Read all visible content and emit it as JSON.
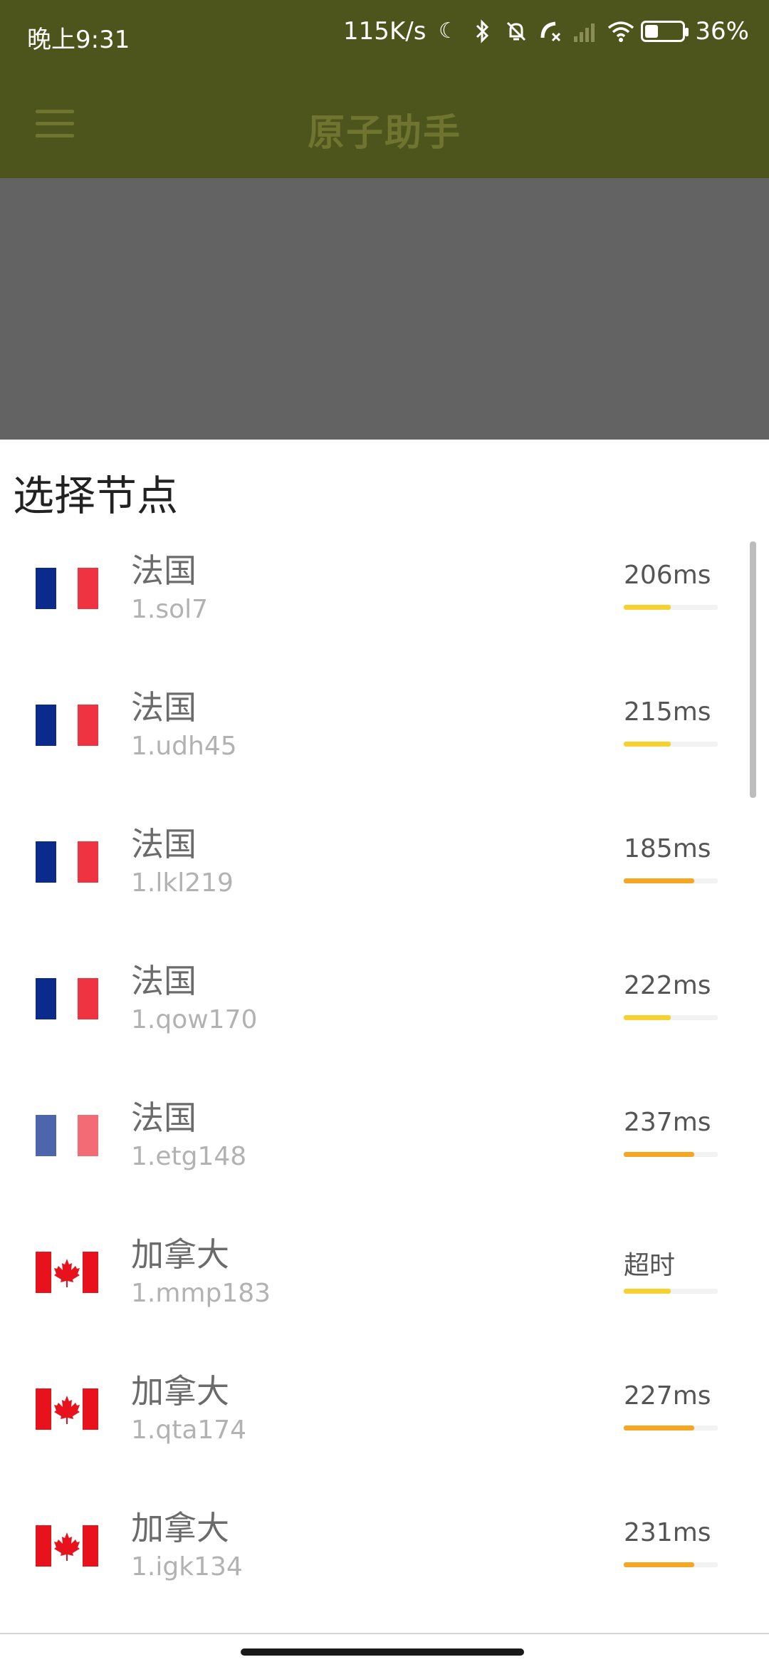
{
  "status_bar": {
    "time": "晚上9:31",
    "network_speed": "115K/s",
    "battery_percent": "36%",
    "battery_level": 0.36,
    "icons": [
      "moon-icon",
      "bluetooth-icon",
      "bell-mute-icon",
      "call-off-icon",
      "signal-icon",
      "wifi-icon",
      "battery-icon"
    ]
  },
  "app_bar": {
    "title": "原子助手",
    "menu_icon": "menu-icon"
  },
  "sheet": {
    "title": "选择节点",
    "nodes": [
      {
        "country": "法国",
        "flag": "fr",
        "node": "1.sol7",
        "ping": "206ms",
        "bar_fraction": 0.5,
        "bar_color": "#f5d22f"
      },
      {
        "country": "法国",
        "flag": "fr",
        "node": "1.udh45",
        "ping": "215ms",
        "bar_fraction": 0.5,
        "bar_color": "#f5d22f"
      },
      {
        "country": "法国",
        "flag": "fr",
        "node": "1.lkl219",
        "ping": "185ms",
        "bar_fraction": 0.75,
        "bar_color": "#f5a623"
      },
      {
        "country": "法国",
        "flag": "fr",
        "node": "1.qow170",
        "ping": "222ms",
        "bar_fraction": 0.5,
        "bar_color": "#f5d22f"
      },
      {
        "country": "法国",
        "flag": "fr",
        "node": "1.etg148",
        "ping": "237ms",
        "bar_fraction": 0.75,
        "bar_color": "#f5a623"
      },
      {
        "country": "加拿大",
        "flag": "ca",
        "node": "1.mmp183",
        "ping": "超时",
        "bar_fraction": 0.5,
        "bar_color": "#f5d22f"
      },
      {
        "country": "加拿大",
        "flag": "ca",
        "node": "1.qta174",
        "ping": "227ms",
        "bar_fraction": 0.75,
        "bar_color": "#f5a623"
      },
      {
        "country": "加拿大",
        "flag": "ca",
        "node": "1.igk134",
        "ping": "231ms",
        "bar_fraction": 0.75,
        "bar_color": "#f5a623"
      }
    ]
  }
}
